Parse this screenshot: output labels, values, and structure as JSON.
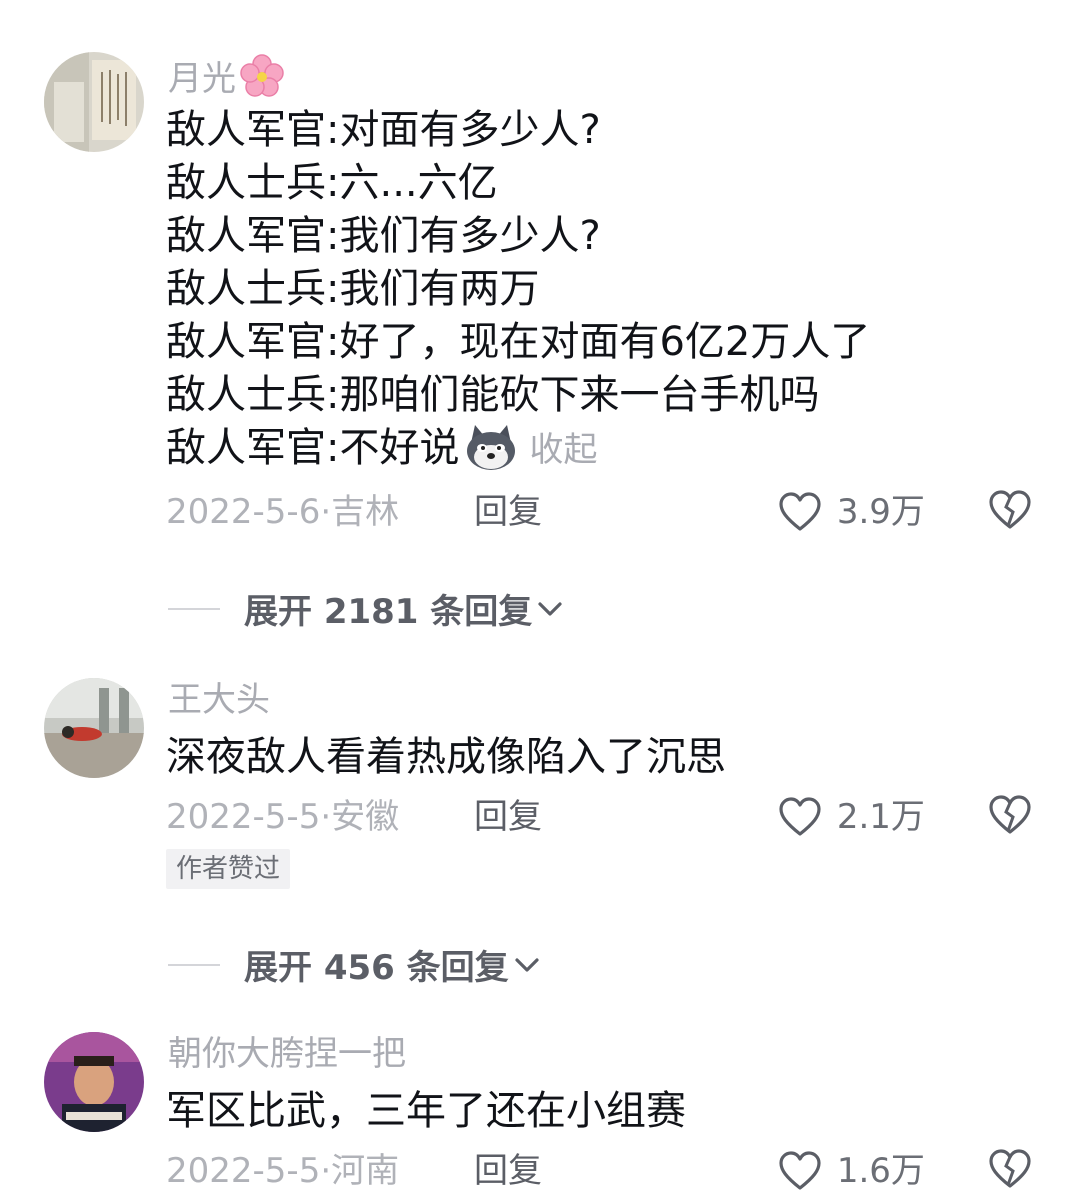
{
  "comments": [
    {
      "username": "月光",
      "lines": [
        "敌人军官:对面有多少人?",
        "敌人士兵:六...六亿",
        "敌人军官:我们有多少人?",
        "敌人士兵:我们有两万",
        "敌人军官:好了，现在对面有6亿2万人了",
        "敌人士兵:那咱们能砍下来一台手机吗",
        "敌人军官:不好说"
      ],
      "collapse_label": "收起",
      "date_location": "2022-5-6·吉林",
      "reply_label": "回复",
      "likes": "3.9万",
      "expand_label": "展开 2181 条回复"
    },
    {
      "username": "王大头",
      "lines": [
        "深夜敌人看着热成像陷入了沉思"
      ],
      "date_location": "2022-5-5·安徽",
      "reply_label": "回复",
      "likes": "2.1万",
      "badge": "作者赞过",
      "expand_label": "展开 456 条回复"
    },
    {
      "username": "朝你大胯捏一把",
      "lines": [
        "军区比武，三年了还在小组赛"
      ],
      "date_location": "2022-5-5·河南",
      "reply_label": "回复",
      "likes": "1.6万"
    }
  ],
  "icons": {
    "like": "heart-outline-icon",
    "dislike": "broken-heart-icon",
    "expand": "chevron-down-icon",
    "emoji_flower": "cherry-blossom-icon",
    "emoji_dog": "husky-dog-icon"
  },
  "colors": {
    "text": "#111318",
    "secondary": "#a9abb2",
    "reply": "#5b5e66"
  }
}
